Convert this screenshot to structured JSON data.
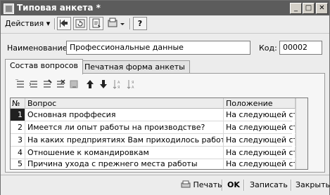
{
  "window": {
    "title": "Типовая анкета *",
    "minimize_glyph": "_",
    "maximize_glyph": "□",
    "close_glyph": "✕"
  },
  "toolbar": {
    "actions_label": "Действия",
    "actions_arrow": "▾",
    "help_glyph": "?"
  },
  "form": {
    "name_label": "Наименование:",
    "name_value": "Профессиональные данные",
    "code_label": "Код:",
    "code_value": "00002"
  },
  "tabs": [
    {
      "label": "Состав вопросов",
      "active": true
    },
    {
      "label": "Печатная форма анкеты",
      "active": false
    }
  ],
  "grid_toolbar": {
    "icons": [
      "add-row-icon",
      "copy-row-icon",
      "edit-row-icon",
      "delete-row-icon",
      "end-edit-icon",
      "move-up-icon",
      "move-down-icon",
      "sort-asc-icon",
      "sort-desc-icon"
    ],
    "up_glyph": "↑",
    "down_glyph": "↓"
  },
  "table": {
    "columns": [
      "№",
      "Вопрос",
      "Положение"
    ],
    "rows": [
      {
        "num": "1",
        "question": "Основная проффесия",
        "position": "На следующей строке"
      },
      {
        "num": "2",
        "question": "Имеется ли опыт работы на производстве?",
        "position": "На следующей строке"
      },
      {
        "num": "3",
        "question": "На каких предприятиях Вам приходилось работать?",
        "position": "На следующей строке"
      },
      {
        "num": "4",
        "question": "Отношение к командировкам",
        "position": "На следующей строке"
      },
      {
        "num": "5",
        "question": "Причина ухода с прежнего места работы",
        "position": "На следующей строке"
      }
    ],
    "selected_row": 0
  },
  "footer": {
    "print_label": "Печать",
    "ok_label": "OK",
    "save_label": "Записать",
    "close_label": "Закрыть"
  }
}
